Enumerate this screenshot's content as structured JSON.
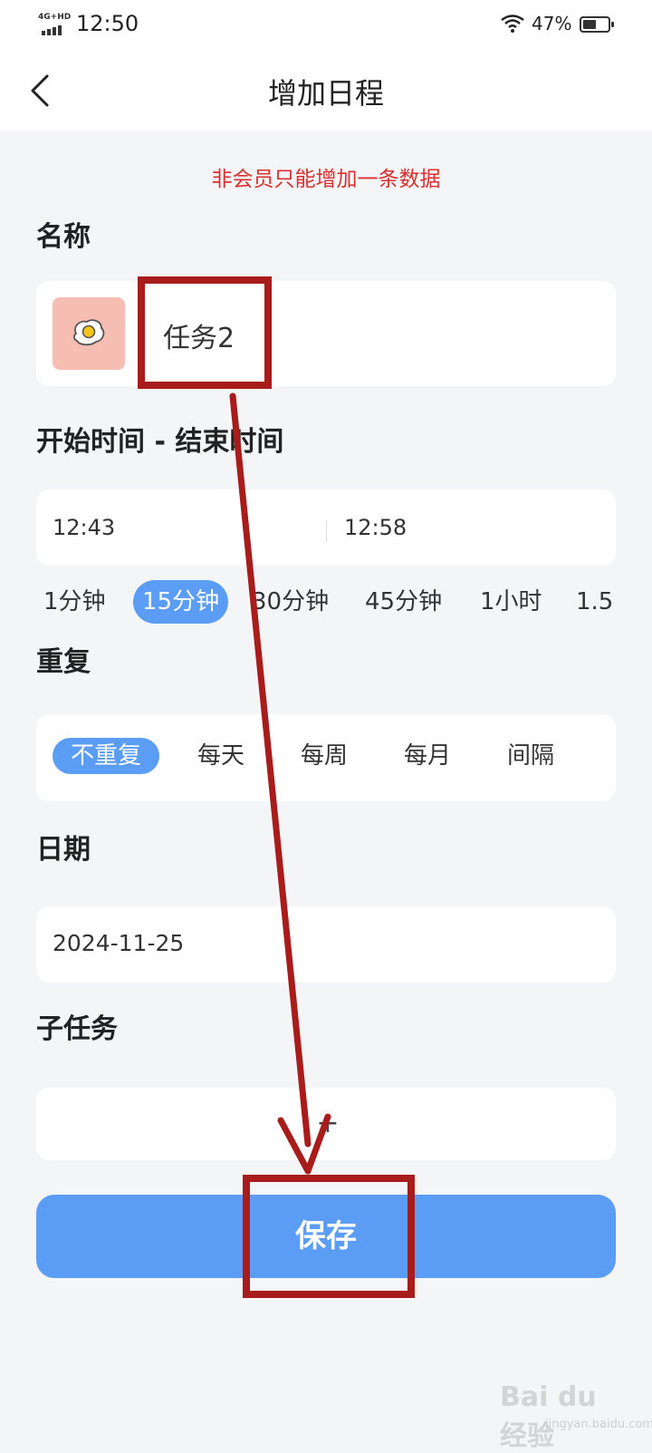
{
  "status_bar": {
    "network": "4G+HD",
    "time": "12:50",
    "battery_percent": "47%"
  },
  "header": {
    "title": "增加日程"
  },
  "notice": "非会员只能增加一条数据",
  "name_section": {
    "label": "名称",
    "icon": "fried-egg-icon",
    "value": "任务2"
  },
  "time_section": {
    "label": "开始时间 - 结束时间",
    "start": "12:43",
    "end": "12:58",
    "durations": [
      "1分钟",
      "15分钟",
      "30分钟",
      "45分钟",
      "1小时",
      "1.5"
    ],
    "selected_duration": "15分钟"
  },
  "repeat_section": {
    "label": "重复",
    "options": [
      "不重复",
      "每天",
      "每周",
      "每月",
      "间隔"
    ],
    "selected": "不重复"
  },
  "date_section": {
    "label": "日期",
    "value": "2024-11-25"
  },
  "subtask_section": {
    "label": "子任务",
    "add_label": "+"
  },
  "save_button": {
    "label": "保存"
  },
  "watermark": {
    "logo": "Bai du 经验",
    "sub": "jingyan.baidu.com"
  },
  "colors": {
    "accent": "#5b9cf5",
    "notice_red": "#d93030",
    "annotation_red": "#a81c1c",
    "icon_bg": "#f6beb3"
  }
}
